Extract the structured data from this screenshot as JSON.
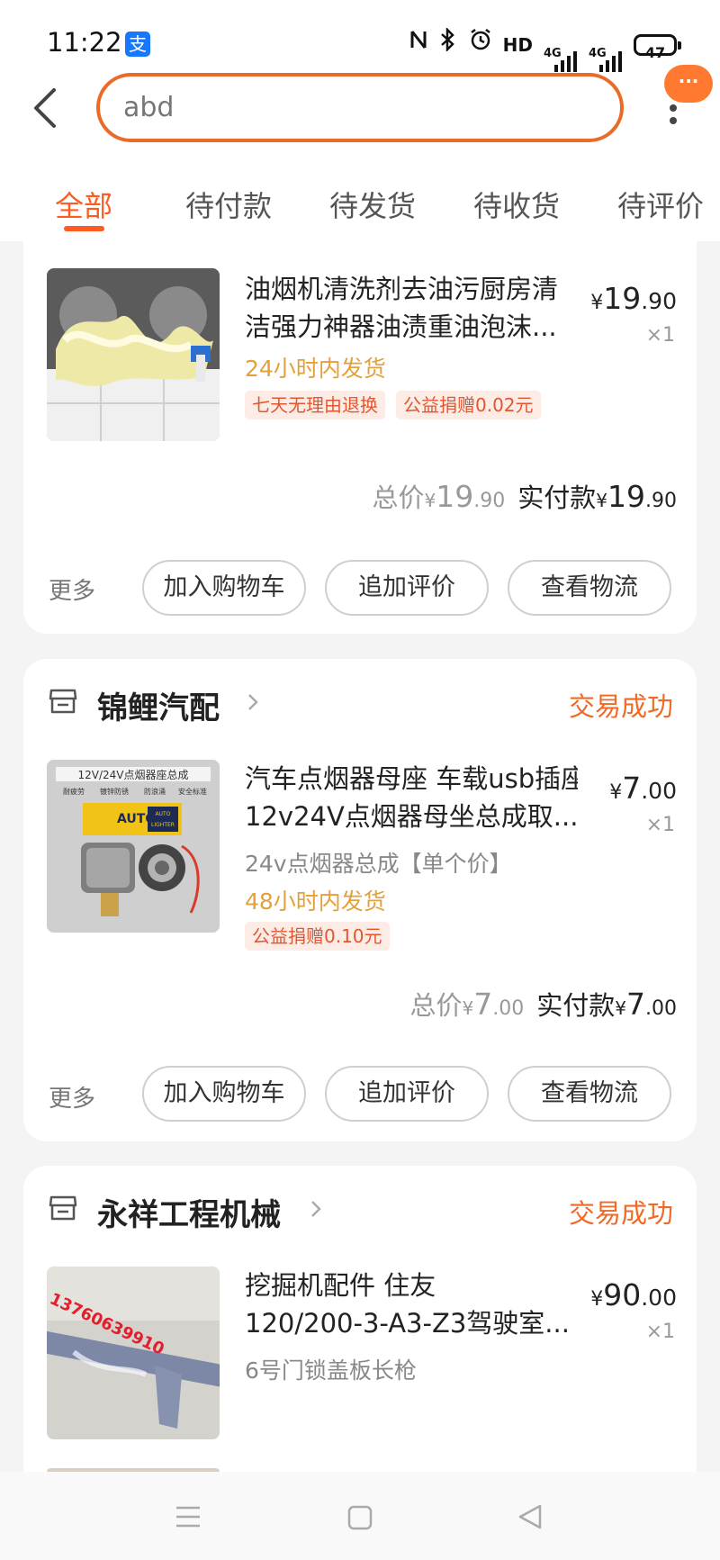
{
  "status_bar": {
    "time": "11:22",
    "app_badge": "支",
    "icons": [
      "nfc-icon",
      "bluetooth-icon",
      "alarm-icon",
      "hd-icon",
      "signal-4g-icon",
      "signal-4g-icon",
      "battery-icon"
    ],
    "hd": "HD",
    "net1": "4G",
    "net2": "4G",
    "battery": "47"
  },
  "header": {
    "search_value": "abd",
    "more_bubble": "···"
  },
  "tabs": [
    {
      "label": "全部",
      "active": true
    },
    {
      "label": "待付款",
      "active": false
    },
    {
      "label": "待发货",
      "active": false
    },
    {
      "label": "待收货",
      "active": false
    },
    {
      "label": "待评价",
      "active": false
    }
  ],
  "orders": [
    {
      "title_line1": "油烟机清洗剂去油污厨房清",
      "title_line2": "洁强力神器油渍重油泡沫...",
      "ship": "24小时内发货",
      "tags": [
        "七天无理由退换",
        "公益捐赠0.02元"
      ],
      "price": {
        "yen": "¥",
        "int": "19",
        "dec": ".90"
      },
      "qty": "×1",
      "total_label": "总价",
      "total": {
        "yen": "¥",
        "int": "19",
        "dec": ".90"
      },
      "paid_label": "实付款",
      "paid": {
        "yen": "¥",
        "int": "19",
        "dec": ".90"
      },
      "more": "更多",
      "buttons": [
        "加入购物车",
        "追加评价",
        "查看物流"
      ]
    },
    {
      "shop": "锦鲤汽配",
      "status": "交易成功",
      "title_line1": "汽车点烟器母座 车载usb插座",
      "title_line2": "12v24V点烟器母坐总成取...",
      "sku": "24v点烟器总成【单个价】",
      "ship": "48小时内发货",
      "tags": [
        "公益捐赠0.10元"
      ],
      "price": {
        "yen": "¥",
        "int": "7",
        "dec": ".00"
      },
      "qty": "×1",
      "total_label": "总价",
      "total": {
        "yen": "¥",
        "int": "7",
        "dec": ".00"
      },
      "paid_label": "实付款",
      "paid": {
        "yen": "¥",
        "int": "7",
        "dec": ".00"
      },
      "more": "更多",
      "buttons": [
        "加入购物车",
        "追加评价",
        "查看物流"
      ],
      "thumb_text": {
        "banner": "12V/24V点烟器座总成",
        "feature1": "耐疲劳",
        "feature2": "镀锌防锈",
        "feature3": "防浪涌",
        "feature4": "安全标准",
        "brand": "AUTO",
        "product": "LIGHTER"
      }
    },
    {
      "shop": "永祥工程机械",
      "status": "交易成功",
      "title_line1": "挖掘机配件 住友",
      "title_line2": "120/200-3-A3-Z3驾驶室...",
      "sku": "6号门锁盖板长枪",
      "price": {
        "yen": "¥",
        "int": "90",
        "dec": ".00"
      },
      "qty": "×1",
      "thumb_text": {
        "watermark": "13760639910"
      }
    }
  ]
}
